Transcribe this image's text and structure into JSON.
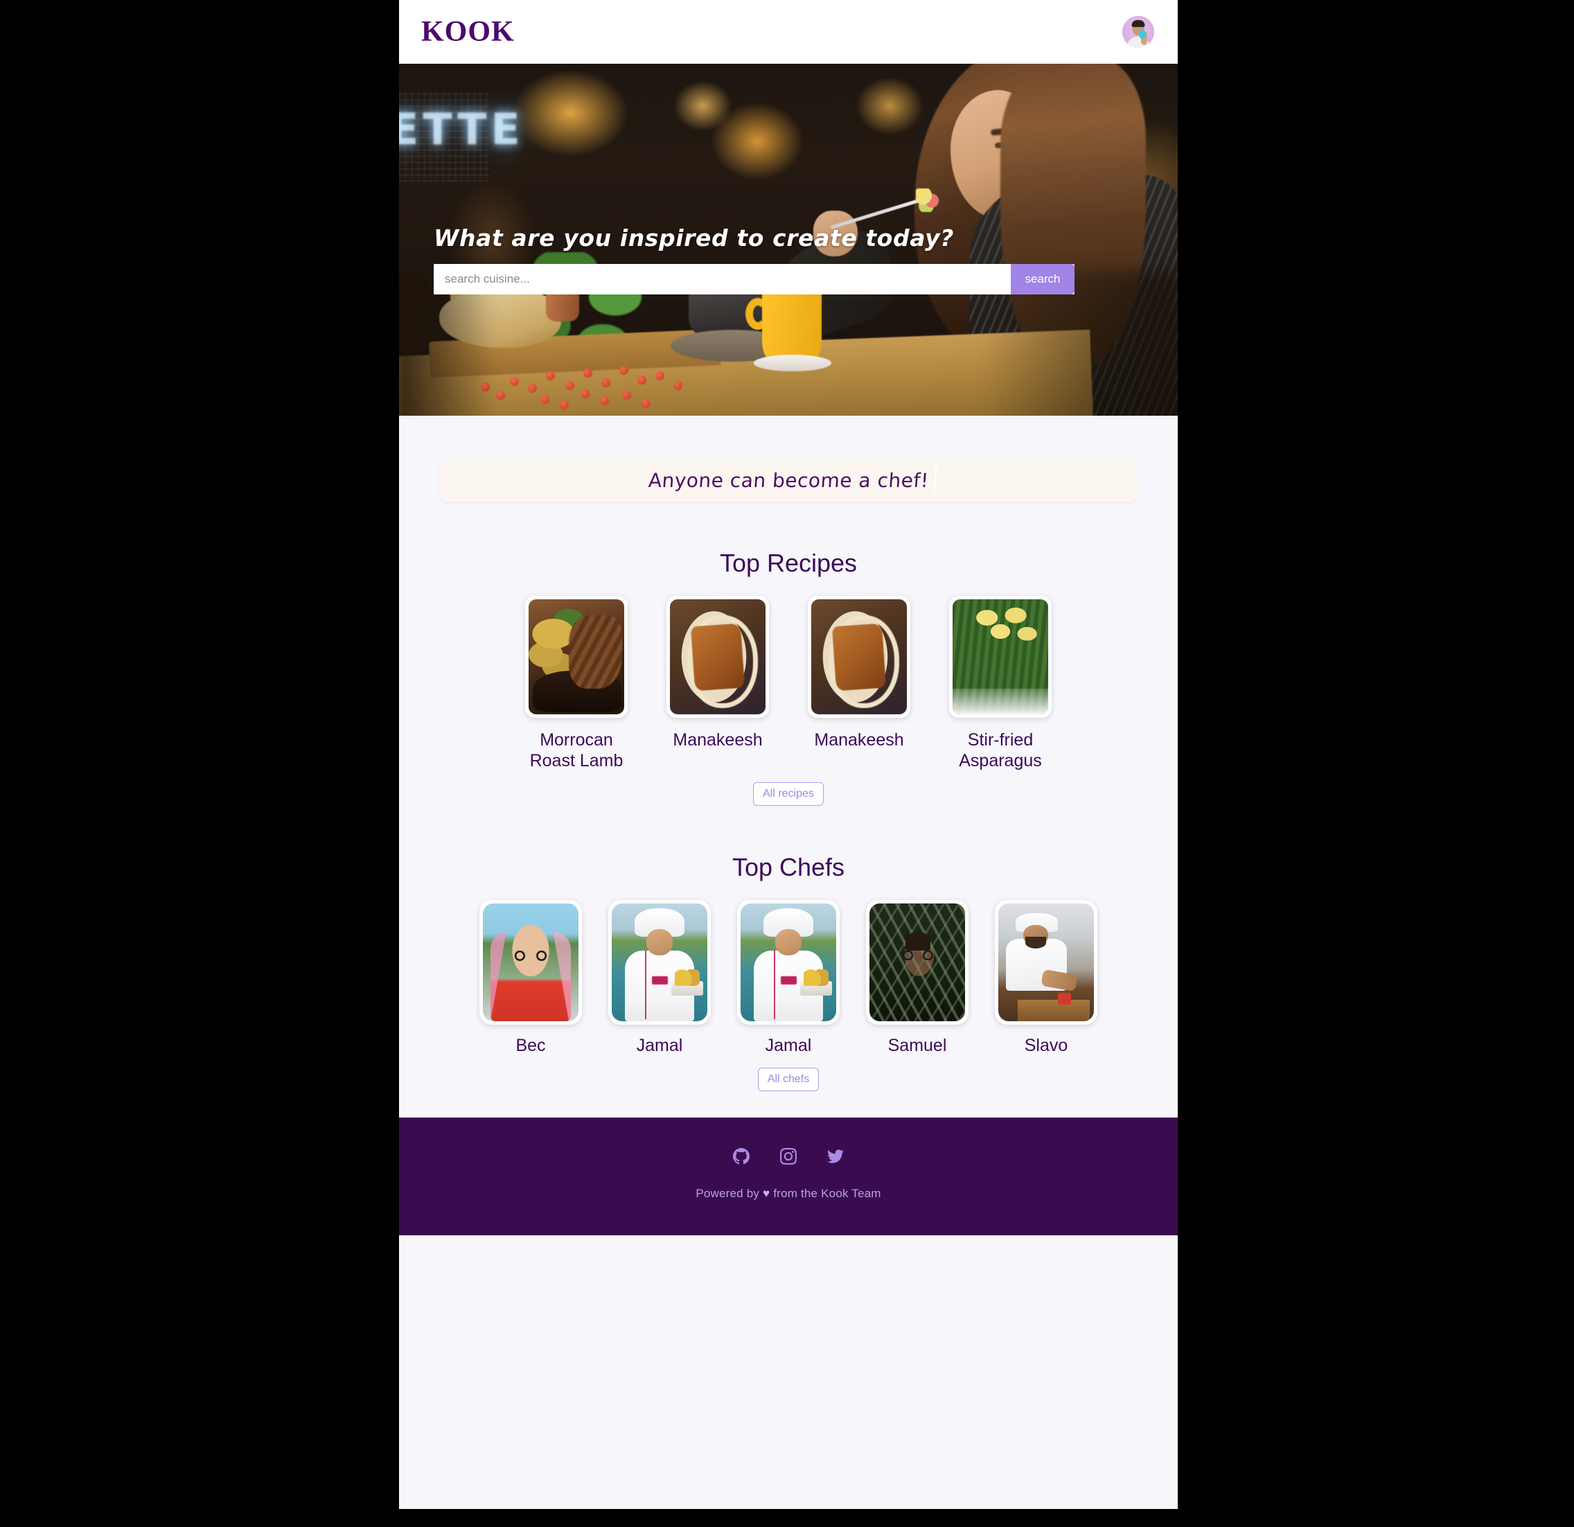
{
  "brand": "KOOK",
  "header": {
    "avatar_name": "user-avatar"
  },
  "hero": {
    "title": "What are you inspired to create today?",
    "neon_sign": "ETTE",
    "search_placeholder": "search cuisine...",
    "search_value": "",
    "search_button": "search"
  },
  "banner": {
    "text": "Anyone can become a chef!"
  },
  "recipes": {
    "title": "Top Recipes",
    "items": [
      {
        "name": "Morrocan Roast Lamb",
        "art": "art-lamb"
      },
      {
        "name": "Manakeesh",
        "art": "art-manakeesh"
      },
      {
        "name": "Manakeesh",
        "art": "art-manakeesh"
      },
      {
        "name": "Stir-fried Asparagus",
        "art": "art-asparagus"
      }
    ],
    "all_button": "All recipes"
  },
  "chefs": {
    "title": "Top Chefs",
    "items": [
      {
        "name": "Bec",
        "art": "art-bec"
      },
      {
        "name": "Jamal",
        "art": "art-jamal"
      },
      {
        "name": "Jamal",
        "art": "art-jamal"
      },
      {
        "name": "Samuel",
        "art": "art-samuel"
      },
      {
        "name": "Slavo",
        "art": "art-slavo"
      }
    ],
    "all_button": "All chefs"
  },
  "footer": {
    "social": [
      {
        "name": "github-icon",
        "label": "GitHub"
      },
      {
        "name": "instagram-icon",
        "label": "Instagram"
      },
      {
        "name": "twitter-icon",
        "label": "Twitter"
      }
    ],
    "credit_prefix": "Powered by ",
    "heart": "♥",
    "credit_suffix": " from the Kook Team"
  },
  "colors": {
    "brand_purple": "#4b0a6b",
    "accent_purple": "#a184e8",
    "footer_purple": "#3b0b50",
    "page_bg": "#f7f6fa",
    "banner_bg": "#fbf6ef",
    "heading": "#3c0a59"
  }
}
